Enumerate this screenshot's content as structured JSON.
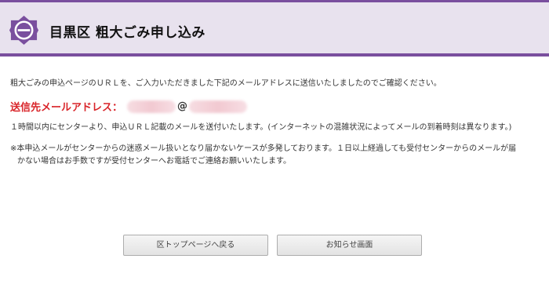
{
  "header": {
    "title": "目黒区 粗大ごみ申し込み",
    "emblem_icon": "meguro-ward-emblem",
    "accent_color": "#7a4f9e",
    "background_color": "#e8e2ee"
  },
  "main": {
    "intro": "粗大ごみの申込ページのＵＲＬを、ご入力いただきました下記のメールアドレスに送信いたしましたのでご確認ください。",
    "email_label": "送信先メールアドレス：",
    "email_separator": "@",
    "email_label_color": "#d9252a",
    "notice_time": "１時間以内にセンターより、申込ＵＲＬ記載のメールを送付いたします。(インターネットの混雑状況によってメールの到着時刻は異なります。)",
    "notice_spam_line1": "※本申込メールがセンターからの迷惑メール扱いとなり届かないケースが多発しております。１日以上経過しても受付センターからのメールが届",
    "notice_spam_line2": "かない場合はお手数ですが受付センターへお電話でご連絡お願いいたします。"
  },
  "buttons": {
    "back_to_top": "区トップページへ戻る",
    "notice_screen": "お知らせ画面"
  }
}
